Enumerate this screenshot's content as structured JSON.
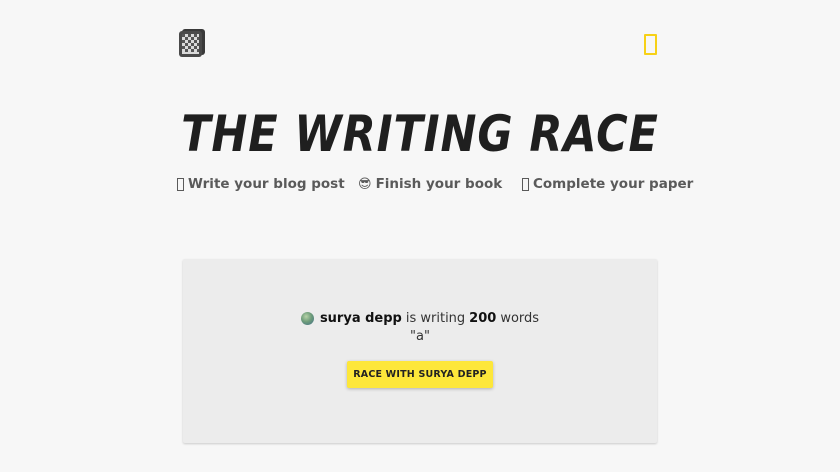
{
  "header": {
    "logo_icon": "notebook-logo-icon",
    "menu_icon": "menu-icon",
    "accent_color": "#f7d117"
  },
  "hero": {
    "title": "THE WRITING RACE",
    "taglines": [
      {
        "icon": "blank-glyph",
        "text": "Write your blog post"
      },
      {
        "icon": "smiley-glyph",
        "text": "Finish your book"
      },
      {
        "icon": "blank-glyph",
        "text": "Complete your paper"
      }
    ]
  },
  "race_card": {
    "user_name": "surya depp",
    "is_writing_text": "is writing",
    "word_count": "200",
    "words_label": "words",
    "piece_title": "\"a\"",
    "button_label": "RACE WITH SURYA DEPP",
    "button_color": "#fde73a"
  }
}
